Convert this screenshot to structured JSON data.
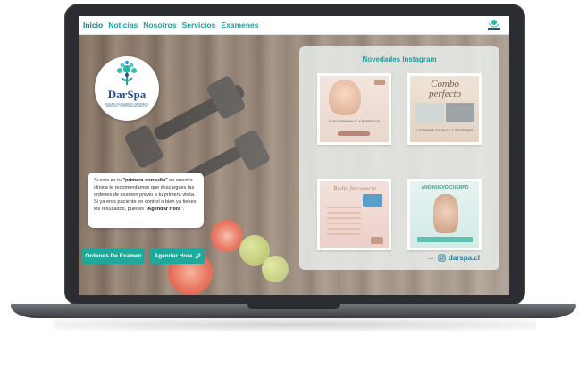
{
  "nav": {
    "items": [
      "Inicio",
      "Noticias",
      "Nosotros",
      "Servicios",
      "Examenes"
    ]
  },
  "logo": {
    "name": "DarSpa",
    "subtitle": "MASAJES, ALINEAMIENTO, ABDOMEN, Y ARRUGAS Y CORPORAL DE REDUCIR"
  },
  "info": {
    "p1": "Si esta es tu ",
    "b1": "\"primera consulta\"",
    "p2": " en nuestra clínica te recomendamos que descargues las ordenes de examen previo a tu primera visita. Si ya eres paciente en control o bien ya tienes los resultados, puedes ",
    "b2": "\"Agendar Hora\"",
    "p3": "."
  },
  "buttons": {
    "orders": "Ordenes De Examen",
    "schedule": "Agendar Hora"
  },
  "instagram": {
    "title": "Novedades Instagram",
    "handle": "darspa.cl",
    "posts": [
      {
        "heading": "",
        "caption": "CON VITAMINA C Y PEPTIDOS"
      },
      {
        "heading": "Combo perfecto",
        "caption": "2 RONDAS MICRO Y 2 SESIONES"
      },
      {
        "heading": "Radio frecuencia",
        "caption": ""
      },
      {
        "heading": "ANO NUEVO CUERPO",
        "caption": ""
      }
    ]
  },
  "colors": {
    "accent": "#1fa99a",
    "nav_text": "#1f9e9e",
    "brand_blue": "#23508f"
  }
}
